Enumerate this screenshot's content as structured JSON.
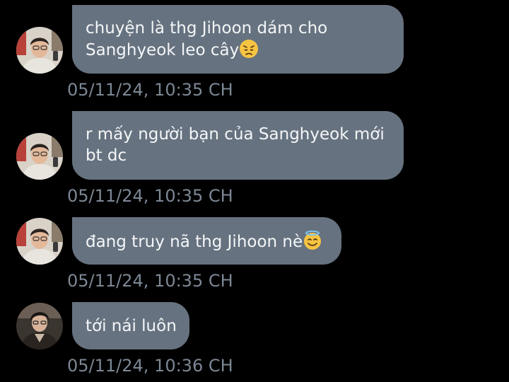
{
  "messages": [
    {
      "sender_avatar": "avatar-man-glasses-beige",
      "lines": [
        "chuyện là thg Jihoon dám cho",
        "Sanghyeok leo cây"
      ],
      "trailing_emoji": "disappointed-face-emoji",
      "timestamp": "05/11/24, 10:35 CH"
    },
    {
      "sender_avatar": "avatar-man-glasses-beige",
      "lines": [
        "r mấy người bạn của Sanghyeok mới",
        "bt dc"
      ],
      "timestamp": "05/11/24, 10:35 CH"
    },
    {
      "sender_avatar": "avatar-man-glasses-beige",
      "lines": [
        "đang truy nã thg Jihoon nè"
      ],
      "trailing_emoji": "smiling-face-with-halo-emoji",
      "timestamp": "05/11/24, 10:35 CH"
    },
    {
      "sender_avatar": "avatar-man-dark-jacket",
      "lines": [
        "tới nái luôn"
      ],
      "timestamp": "05/11/24, 10:36 CH"
    }
  ],
  "colors": {
    "background": "#000000",
    "bubble": "#66727f",
    "bubble_text": "#f4f6f8",
    "timestamp": "#7c8794"
  }
}
